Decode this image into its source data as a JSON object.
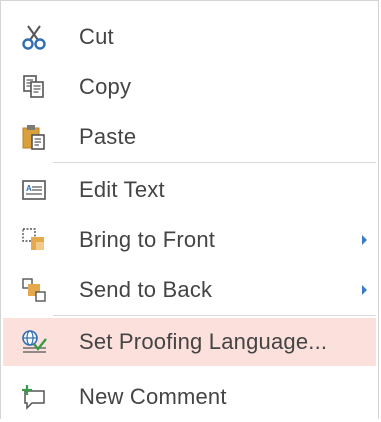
{
  "menu": {
    "items": [
      {
        "label": "Cut",
        "icon": "scissors-icon",
        "submenu": false
      },
      {
        "label": "Copy",
        "icon": "copy-icon",
        "submenu": false
      },
      {
        "label": "Paste",
        "icon": "paste-icon",
        "submenu": false
      },
      {
        "label": "Edit Text",
        "icon": "edit-text-icon",
        "submenu": false
      },
      {
        "label": "Bring to Front",
        "icon": "bring-to-front-icon",
        "submenu": true
      },
      {
        "label": "Send to Back",
        "icon": "send-to-back-icon",
        "submenu": true
      },
      {
        "label": "Set Proofing Language...",
        "icon": "proofing-language-icon",
        "submenu": false,
        "highlighted": true
      },
      {
        "label": "New Comment",
        "icon": "new-comment-icon",
        "submenu": false
      }
    ]
  },
  "colors": {
    "text": "#444444",
    "highlight": "#fbe0dc",
    "accent": "#3b7cc4",
    "paste_orange": "#d9a13b"
  }
}
